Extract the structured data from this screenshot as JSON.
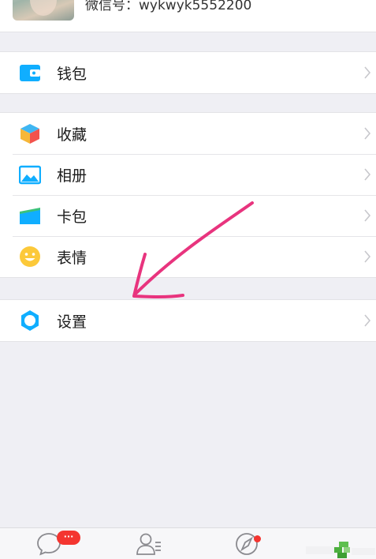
{
  "profile": {
    "wechat_id": "微信号：wykwyk5552200"
  },
  "menu": {
    "wallet": "钱包",
    "favorites": "收藏",
    "album": "相册",
    "card_wallet": "卡包",
    "stickers": "表情",
    "settings": "设置"
  },
  "tabbar": {
    "chats_badge": "···"
  },
  "colors": {
    "accent_blue": "#10aeff",
    "badge_red": "#f43530",
    "annotation_pink": "#e8347e",
    "background": "#efeff4"
  },
  "icons": {
    "wallet": "wallet-icon",
    "favorites": "cube-icon",
    "album": "picture-icon",
    "card_wallet": "card-icon",
    "stickers": "smiley-icon",
    "settings": "gear-icon"
  }
}
